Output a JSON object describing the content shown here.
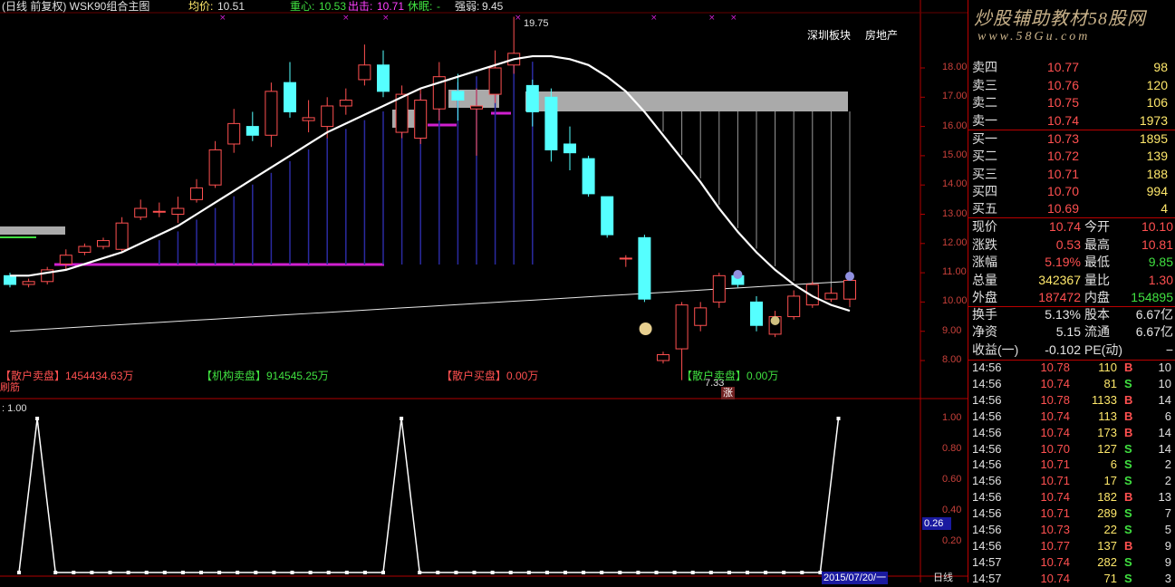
{
  "header": {
    "chart_title": "(日线 前复权) WSK90组合主图",
    "junjia_label": "均价:",
    "junjia_value": "10.51",
    "zhongxin_label": "重心:",
    "zhongxin_value": "10.53",
    "chuji_label": "出击:",
    "chuji_value": "10.71",
    "xiumian_label": "休眠:",
    "xiumian_value": "-",
    "qiangruo_label": "强弱:",
    "qiangruo_value": "9.45"
  },
  "tags": {
    "sector": "深圳板块",
    "industry": "房地产"
  },
  "annotations": {
    "high_price": "19.75",
    "low_price": "7.33",
    "zhang": "涨"
  },
  "money_flow": {
    "item1": "【散户卖盘】1454434.63万",
    "item2": "【机构卖盘】914545.25万",
    "item3": "【散户买盘】0.00万",
    "item4": "【散户卖盘】0.00万"
  },
  "indicator": {
    "name": "刷筋",
    "value_label": ": 1.00",
    "current_value": "0.26"
  },
  "price_axis": [
    "18.00",
    "17.00",
    "16.00",
    "15.00",
    "14.00",
    "13.00",
    "12.00",
    "11.00",
    "10.00",
    "9.00",
    "8.00"
  ],
  "indicator_axis": [
    "1.00",
    "0.80",
    "0.60",
    "0.40",
    "0.20"
  ],
  "bottom_bar": {
    "date": "2015/07/20/一",
    "period": "日线"
  },
  "watermark": {
    "line1": "炒股辅助教材58股网",
    "line2": "www.58Gu.com"
  },
  "quote": {
    "asks": [
      {
        "name": "卖四",
        "price": "10.77",
        "vol": "98"
      },
      {
        "name": "卖三",
        "price": "10.76",
        "vol": "120"
      },
      {
        "name": "卖二",
        "price": "10.75",
        "vol": "106"
      },
      {
        "name": "卖一",
        "price": "10.74",
        "vol": "1973"
      }
    ],
    "bids": [
      {
        "name": "买一",
        "price": "10.73",
        "vol": "1895"
      },
      {
        "name": "买二",
        "price": "10.72",
        "vol": "139"
      },
      {
        "name": "买三",
        "price": "10.71",
        "vol": "188"
      },
      {
        "name": "买四",
        "price": "10.70",
        "vol": "994"
      },
      {
        "name": "买五",
        "price": "10.69",
        "vol": "4"
      }
    ],
    "stats": [
      {
        "l": "现价",
        "lv": "10.74",
        "r": "今开",
        "rv": "10.10"
      },
      {
        "l": "涨跌",
        "lv": "0.53",
        "r": "最高",
        "rv": "10.81"
      },
      {
        "l": "涨幅",
        "lv": "5.19%",
        "r": "最低",
        "rv": "9.85"
      },
      {
        "l": "总量",
        "lv": "342367",
        "r": "量比",
        "rv": "1.30"
      },
      {
        "l": "外盘",
        "lv": "187472",
        "r": "内盘",
        "rv": "154895"
      }
    ],
    "finance": [
      {
        "l": "换手",
        "lv": "5.13%",
        "r": "股本",
        "rv": "6.67亿"
      },
      {
        "l": "净资",
        "lv": "5.15",
        "r": "流通",
        "rv": "6.67亿"
      },
      {
        "l": "收益(一)",
        "lv": "-0.102",
        "r": "PE(动)",
        "rv": "−"
      }
    ],
    "trades": [
      {
        "t": "14:56",
        "p": "10.78",
        "v": "110",
        "bs": "B",
        "n": "10"
      },
      {
        "t": "14:56",
        "p": "10.74",
        "v": "81",
        "bs": "S",
        "n": "10"
      },
      {
        "t": "14:56",
        "p": "10.78",
        "v": "1133",
        "bs": "B",
        "n": "14"
      },
      {
        "t": "14:56",
        "p": "10.74",
        "v": "113",
        "bs": "B",
        "n": "6"
      },
      {
        "t": "14:56",
        "p": "10.74",
        "v": "173",
        "bs": "B",
        "n": "14"
      },
      {
        "t": "14:56",
        "p": "10.70",
        "v": "127",
        "bs": "S",
        "n": "14"
      },
      {
        "t": "14:56",
        "p": "10.71",
        "v": "6",
        "bs": "S",
        "n": "2"
      },
      {
        "t": "14:56",
        "p": "10.71",
        "v": "17",
        "bs": "S",
        "n": "2"
      },
      {
        "t": "14:56",
        "p": "10.74",
        "v": "182",
        "bs": "B",
        "n": "13"
      },
      {
        "t": "14:56",
        "p": "10.71",
        "v": "289",
        "bs": "S",
        "n": "7"
      },
      {
        "t": "14:56",
        "p": "10.73",
        "v": "22",
        "bs": "S",
        "n": "5"
      },
      {
        "t": "14:56",
        "p": "10.77",
        "v": "137",
        "bs": "B",
        "n": "9"
      },
      {
        "t": "14:57",
        "p": "10.74",
        "v": "282",
        "bs": "S",
        "n": "9"
      },
      {
        "t": "14:57",
        "p": "10.74",
        "v": "71",
        "bs": "S",
        "n": "3"
      }
    ]
  },
  "colors": {
    "up": "#ff5050",
    "down": "#55ffff",
    "ma": "#ffffff",
    "purple": "#d020d0",
    "grid": "#b00000"
  },
  "chart_data": {
    "type": "candlestick",
    "ylim": [
      7.5,
      20.3
    ],
    "candles": [
      [
        10.9,
        10.6,
        11.0,
        10.5
      ],
      [
        10.6,
        10.7,
        10.8,
        10.5
      ],
      [
        10.7,
        11.1,
        11.2,
        10.6
      ],
      [
        11.3,
        11.6,
        11.8,
        11.1
      ],
      [
        11.7,
        11.9,
        12.0,
        11.6
      ],
      [
        11.9,
        12.1,
        12.2,
        11.8
      ],
      [
        11.8,
        12.7,
        12.9,
        11.7
      ],
      [
        12.9,
        13.2,
        13.5,
        12.8
      ],
      [
        13.1,
        13.1,
        13.4,
        12.9
      ],
      [
        13.0,
        13.2,
        13.6,
        12.7
      ],
      [
        13.5,
        13.9,
        14.2,
        13.4
      ],
      [
        14.0,
        15.2,
        15.5,
        13.9
      ],
      [
        15.4,
        16.1,
        16.6,
        15.1
      ],
      [
        16.0,
        15.7,
        16.5,
        15.5
      ],
      [
        15.7,
        17.2,
        17.5,
        15.3
      ],
      [
        17.5,
        16.5,
        18.2,
        16.3
      ],
      [
        16.2,
        16.3,
        16.9,
        15.8
      ],
      [
        16.0,
        16.7,
        17.0,
        15.6
      ],
      [
        16.7,
        16.9,
        17.3,
        16.4
      ],
      [
        17.6,
        18.1,
        18.8,
        17.4
      ],
      [
        18.1,
        17.2,
        18.6,
        17.0
      ],
      [
        15.8,
        17.1,
        17.4,
        15.6
      ],
      [
        15.6,
        16.9,
        17.3,
        15.4
      ],
      [
        16.6,
        17.7,
        18.2,
        16.2
      ],
      [
        17.2,
        16.9,
        17.8,
        16.2
      ],
      [
        16.6,
        16.7,
        17.3,
        15.0
      ],
      [
        17.1,
        18.0,
        18.6,
        16.8
      ],
      [
        18.1,
        18.5,
        19.75,
        17.8
      ],
      [
        17.4,
        16.5,
        17.6,
        16.0
      ],
      [
        17.0,
        15.2,
        17.3,
        14.8
      ],
      [
        15.4,
        15.1,
        16.0,
        14.5
      ],
      [
        14.9,
        13.7,
        15.0,
        13.6
      ],
      [
        13.6,
        12.3,
        13.6,
        12.2
      ],
      [
        11.5,
        11.5,
        11.6,
        11.2
      ],
      [
        12.2,
        10.1,
        12.3,
        10.0
      ],
      [
        8.0,
        8.2,
        8.3,
        7.9
      ],
      [
        8.4,
        9.9,
        10.0,
        7.33
      ],
      [
        9.2,
        9.8,
        10.0,
        9.0
      ],
      [
        10.0,
        10.9,
        11.0,
        9.8
      ],
      [
        10.9,
        10.6,
        11.0,
        10.5
      ],
      [
        10.0,
        9.2,
        10.2,
        9.0
      ],
      [
        8.9,
        9.5,
        9.7,
        8.8
      ],
      [
        9.5,
        10.2,
        10.4,
        9.4
      ],
      [
        9.9,
        10.6,
        10.7,
        9.8
      ],
      [
        10.1,
        10.3,
        10.5,
        10.0
      ],
      [
        10.1,
        10.74,
        10.81,
        9.85
      ]
    ],
    "ma": [
      10.9,
      10.9,
      11.0,
      11.1,
      11.3,
      11.5,
      11.7,
      12.0,
      12.3,
      12.6,
      13.0,
      13.4,
      13.8,
      14.2,
      14.6,
      15.0,
      15.4,
      15.8,
      16.1,
      16.4,
      16.7,
      17.0,
      17.3,
      17.5,
      17.7,
      17.9,
      18.1,
      18.3,
      18.4,
      18.4,
      18.3,
      18.1,
      17.7,
      17.2,
      16.5,
      15.7,
      14.9,
      14.1,
      13.2,
      12.4,
      11.7,
      11.1,
      10.6,
      10.2,
      9.9,
      9.7
    ],
    "indicator_values": [
      0,
      1,
      0,
      0,
      0,
      0,
      0,
      0,
      0,
      0,
      0,
      0,
      0,
      0,
      0,
      0,
      0,
      0,
      0,
      0,
      0,
      1,
      0,
      0,
      0,
      0,
      0,
      0,
      0,
      0,
      0,
      0,
      0,
      0,
      0,
      0,
      0,
      0,
      0,
      0,
      0,
      0,
      0,
      0,
      0,
      1
    ]
  }
}
